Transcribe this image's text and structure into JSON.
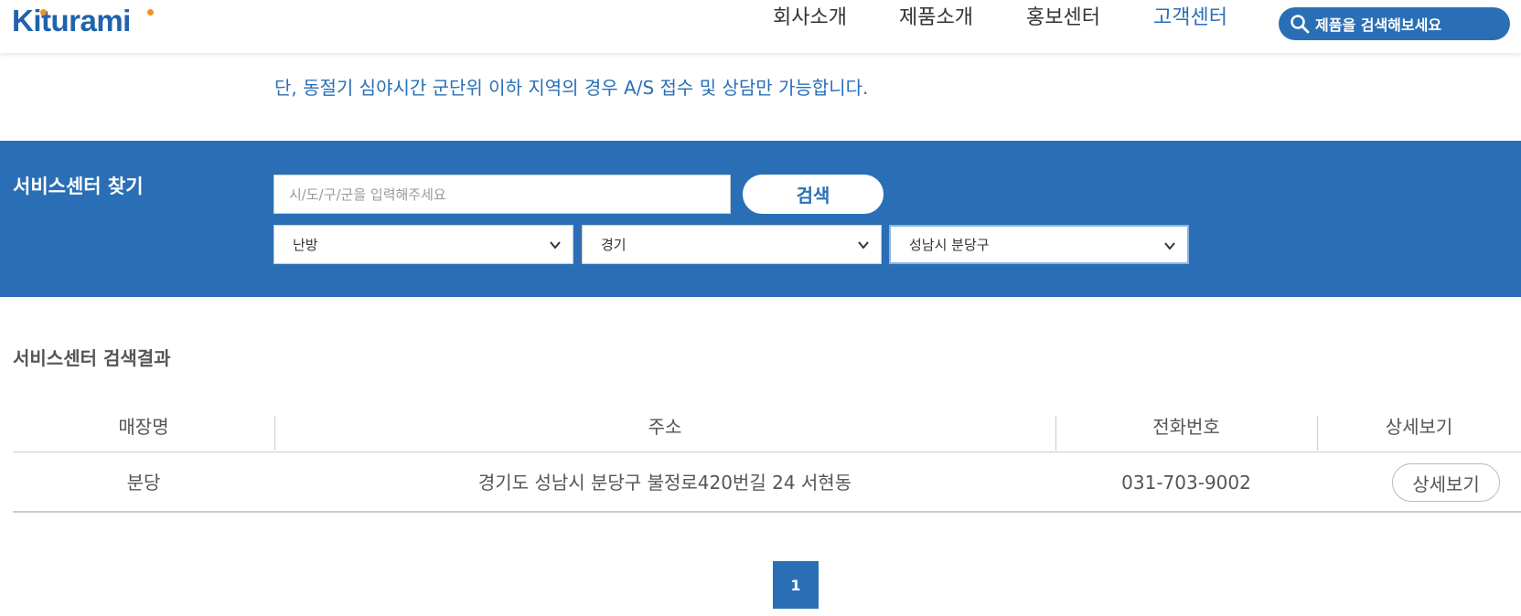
{
  "header": {
    "logo_text": "Kiturami",
    "nav": [
      {
        "label": "회사소개",
        "active": false
      },
      {
        "label": "제품소개",
        "active": false
      },
      {
        "label": "홍보센터",
        "active": false
      },
      {
        "label": "고객센터",
        "active": true
      }
    ],
    "product_search_label": "제품을 검색해보세요"
  },
  "notice": "단, 동절기 심야시간 군단위 이하 지역의 경우 A/S 접수 및 상담만 가능합니다.",
  "finder": {
    "title": "서비스센터 찾기",
    "region_input_placeholder": "시/도/구/군을 입력해주세요",
    "search_button": "검색",
    "selects": [
      {
        "selected": "난방"
      },
      {
        "selected": "경기"
      },
      {
        "selected": "성남시 분당구"
      }
    ]
  },
  "results": {
    "title": "서비스센터 검색결과",
    "columns": [
      "매장명",
      "주소",
      "전화번호",
      "상세보기"
    ],
    "rows": [
      {
        "name": "분당",
        "address": "경기도 성남시 분당구 불정로420번길 24 서현동",
        "phone": "031-703-9002",
        "detail_button": "상세보기"
      }
    ]
  },
  "pagination": {
    "current": "1"
  },
  "colors": {
    "brand_blue": "#2a6fb5",
    "logo_dot": "#f0902a"
  }
}
